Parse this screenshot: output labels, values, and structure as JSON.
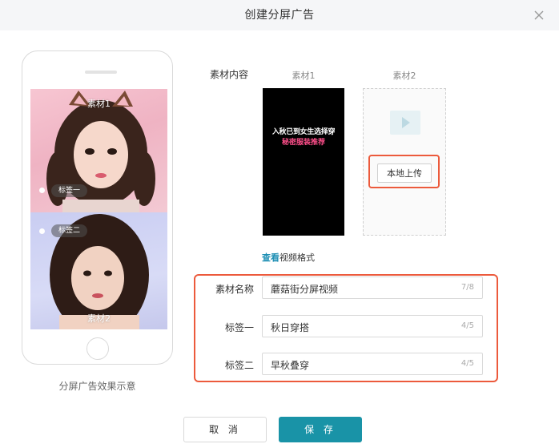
{
  "dialog": {
    "title": "创建分屏广告",
    "close_icon": "close-icon"
  },
  "preview": {
    "top_slot_label": "素材1",
    "bottom_slot_label": "素材2",
    "tag1": "标签一",
    "tag2": "标签二",
    "caption": "分屏广告效果示意"
  },
  "materials": {
    "section_label": "素材内容",
    "col1_label": "素材1",
    "col2_label": "素材2",
    "video1_overlay_line1": "入秋已到女生选择穿",
    "video1_overlay_line2": "秘密服装推荐",
    "upload_button": "本地上传",
    "format_link": "查看",
    "format_link_rest": "视频格式",
    "placeholder_icon": "video-play-icon"
  },
  "form": {
    "fields": [
      {
        "label": "素材名称",
        "value": "蘑菇街分屏视频",
        "count": "7/8"
      },
      {
        "label": "标签一",
        "value": "秋日穿搭",
        "count": "4/5"
      },
      {
        "label": "标签二",
        "value": "早秋叠穿",
        "count": "4/5"
      }
    ]
  },
  "footer": {
    "cancel": "取 消",
    "save": "保 存"
  },
  "colors": {
    "accent": "#1993a7",
    "highlight": "#ec5a3c",
    "link": "#1e8fb4"
  }
}
